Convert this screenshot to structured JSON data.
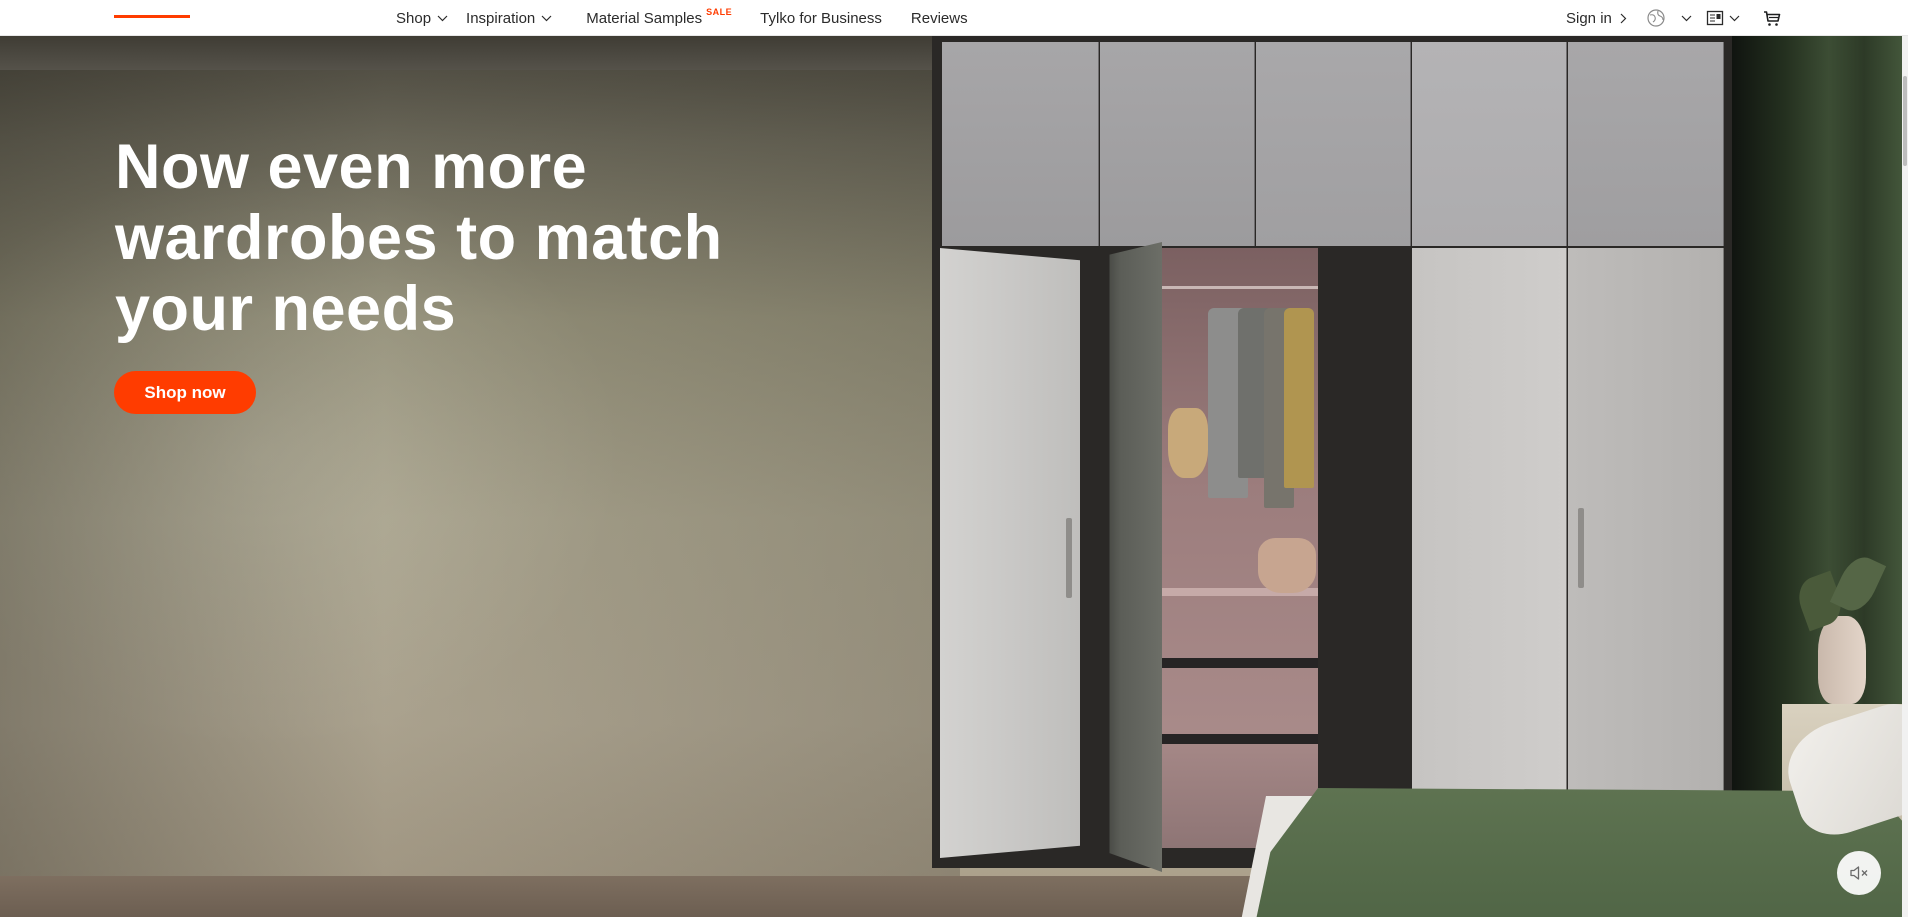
{
  "header": {
    "nav": [
      {
        "label": "Shop",
        "has_dropdown": true
      },
      {
        "label": "Inspiration",
        "has_dropdown": true
      },
      {
        "label": "Material Samples",
        "badge": "SALE"
      },
      {
        "label": "Tylko for Business"
      },
      {
        "label": "Reviews"
      }
    ],
    "signin_label": "Sign in",
    "icons": [
      "globe-icon",
      "magazine-icon",
      "cart-icon"
    ],
    "accent_color": "#ff3c00"
  },
  "hero": {
    "title_line1": "Now even more",
    "title_line2": "wardrobes to match",
    "title_line3": "your needs",
    "cta_label": "Shop now",
    "cta_color": "#ff3c00",
    "mute_icon": "speaker-muted-icon"
  }
}
